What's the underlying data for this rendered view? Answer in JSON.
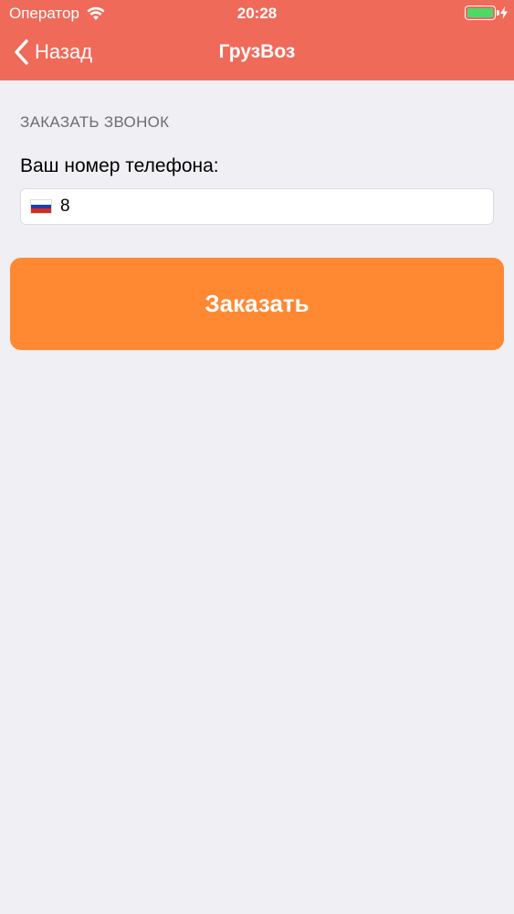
{
  "status_bar": {
    "carrier": "Оператор",
    "time": "20:28",
    "battery_level": 1.0
  },
  "nav_bar": {
    "back_label": "Назад",
    "title": "ГрузВоз"
  },
  "form": {
    "section_header": "ЗАКАЗАТЬ ЗВОНОК",
    "phone_label": "Ваш номер телефона:",
    "phone_value": "8",
    "country_flag": "russia-flag-icon"
  },
  "actions": {
    "order_label": "Заказать"
  },
  "colors": {
    "nav_background": "#f06a59",
    "button_background": "#ff8833",
    "page_background": "#efeff4",
    "battery_fill": "#4cd964"
  }
}
